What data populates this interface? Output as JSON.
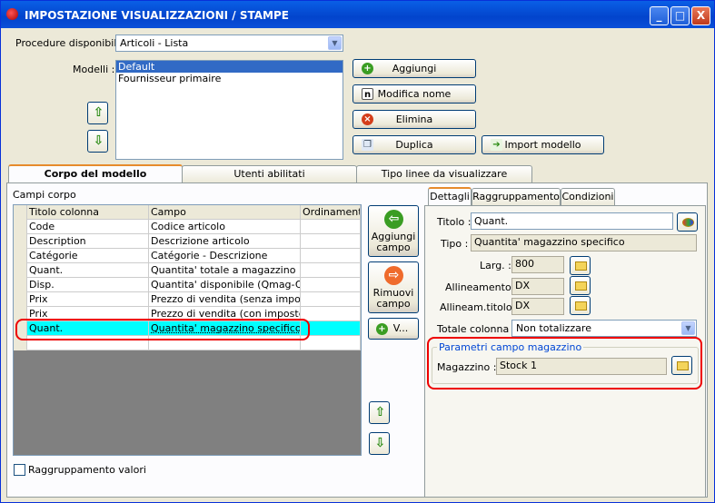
{
  "window": {
    "title": "IMPOSTAZIONE VISUALIZZAZIONI / STAMPE",
    "minimize": "_",
    "maximize": "□",
    "close": "X"
  },
  "top": {
    "procedure_label": "Procedure disponibili :",
    "procedure_value": "Articoli - Lista",
    "modelli_label": "Modelli :",
    "modelli": [
      "Default",
      "Fournisseur primaire"
    ],
    "buttons": {
      "aggiungi": "Aggiungi",
      "modifica": "Modifica nome",
      "elimina": "Elimina",
      "duplica": "Duplica",
      "import": "Import modello"
    }
  },
  "tabs": [
    "Corpo del modello",
    "Utenti abilitati",
    "Tipo linee da visualizzare"
  ],
  "corpo": {
    "campi_label": "Campi corpo",
    "headers": [
      "Titolo colonna",
      "Campo",
      "Ordinamento"
    ],
    "rows": [
      [
        "Code",
        "Codice articolo",
        ""
      ],
      [
        "Description",
        "Descrizione articolo",
        ""
      ],
      [
        "Catégorie",
        "Catégorie - Descrizione",
        ""
      ],
      [
        "Quant.",
        "Quantita' totale a magazzino",
        ""
      ],
      [
        "Disp.",
        "Quantita' disponibile (Qmag-Qord)",
        ""
      ],
      [
        "Prix",
        "Prezzo di vendita (senza imposte)",
        ""
      ],
      [
        "Prix",
        "Prezzo di vendita (con imposte)",
        ""
      ],
      [
        "Quant.",
        "Quantita' magazzino specifico",
        ""
      ]
    ],
    "aggiungi_campo": "Aggiungi campo",
    "rimuovi_campo": "Rimuovi campo",
    "v_button": "V...",
    "raggruppamento_valori": "Raggruppamento valori"
  },
  "details": {
    "tabs": [
      "Dettagli",
      "Raggruppamento",
      "Condizioni"
    ],
    "titolo_label": "Titolo :",
    "titolo_value": "Quant.",
    "tipo_label": "Tipo :",
    "tipo_value": "Quantita' magazzino specifico",
    "larg_label": "Larg. :",
    "larg_value": "800",
    "allineamento_label": "Allineamento :",
    "allineamento_value": "DX",
    "allineam_titolo_label": "Allineam.titolo :",
    "allineam_titolo_value": "DX",
    "totale_label": "Totale colonna :",
    "totale_value": "Non totalizzare",
    "parametri_label": "Parametri campo magazzino",
    "magazzino_label": "Magazzino :",
    "magazzino_value": "Stock 1"
  }
}
